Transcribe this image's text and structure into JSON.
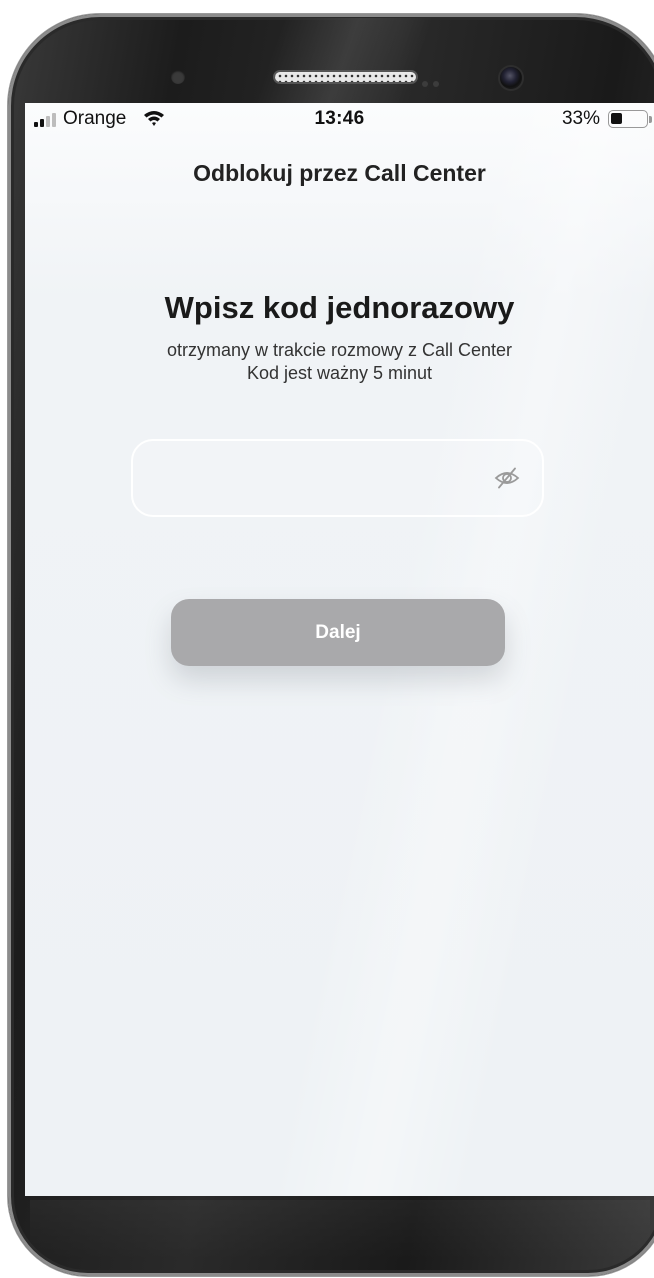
{
  "status_bar": {
    "carrier": "Orange",
    "time": "13:46",
    "battery_percent_text": "33%",
    "battery_level": 0.33,
    "signal_bars_filled": 2,
    "signal_bars_total": 4,
    "icons": [
      "signal-icon",
      "wifi-icon",
      "battery-icon"
    ]
  },
  "nav": {
    "title": "Odblokuj przez Call Center"
  },
  "main": {
    "heading": "Wpisz kod jednorazowy",
    "subtitle_line1": "otrzymany w trakcie rozmowy z Call Center",
    "subtitle_line2": "Kod jest ważny 5 minut",
    "code_input": {
      "value": "",
      "placeholder": "",
      "toggle_icon": "eye-slash-icon"
    },
    "next_button_label": "Dalej"
  },
  "colors": {
    "button_disabled_bg": "#a9a9ab",
    "screen_bg": "#eef2f5",
    "text_primary": "#1a1a1a"
  }
}
